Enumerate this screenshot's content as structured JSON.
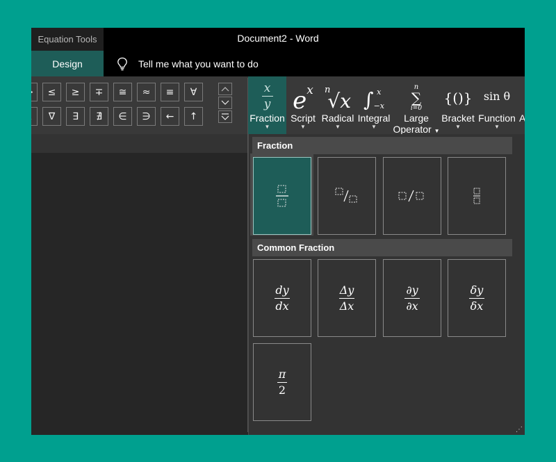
{
  "titlebar": {
    "context_label": "Equation Tools",
    "doc_title": "Document2  -  Word"
  },
  "tabs": {
    "design": "Design",
    "tell_me": "Tell me what you want to do"
  },
  "symbols": {
    "row1": [
      "≫",
      "≤",
      "≥",
      "∓",
      "≅",
      "≈",
      "≡",
      "∀"
    ],
    "row2": [
      "∆",
      "∇",
      "∃",
      "∄",
      "∈",
      "∋",
      "←",
      "↑"
    ]
  },
  "ribbon": {
    "fraction": {
      "glyph_num": "x",
      "glyph_den": "y",
      "label": "Fraction"
    },
    "script": {
      "glyph_base": "e",
      "glyph_sup": "x",
      "label": "Script"
    },
    "radical": {
      "glyph_index": "n",
      "glyph_body": "√x",
      "label": "Radical"
    },
    "integral": {
      "glyph_sym": "∫",
      "glyph_upper": "x",
      "glyph_lower": "−x",
      "label": "Integral"
    },
    "large_operator": {
      "glyph_upper": "n",
      "glyph_sym": "∑",
      "glyph_lower": "i=0",
      "label_line1": "Large",
      "label_line2": "Operator"
    },
    "bracket": {
      "glyph": "{()}",
      "label": "Bracket"
    },
    "function": {
      "glyph": "sin θ",
      "label": "Function"
    },
    "accent_partial": {
      "label": "A"
    }
  },
  "gallery": {
    "fraction_header": "Fraction",
    "common_header": "Common Fraction",
    "common": [
      {
        "num": "dy",
        "den": "dx"
      },
      {
        "num": "Δy",
        "den": "Δx"
      },
      {
        "num": "∂y",
        "den": "∂x"
      },
      {
        "num": "δy",
        "den": "δx"
      },
      {
        "num": "π",
        "den": "2"
      }
    ]
  },
  "colors": {
    "accent": "#1e5d58",
    "background": "#00a08f",
    "window": "#262626",
    "ribbon": "#393939"
  }
}
